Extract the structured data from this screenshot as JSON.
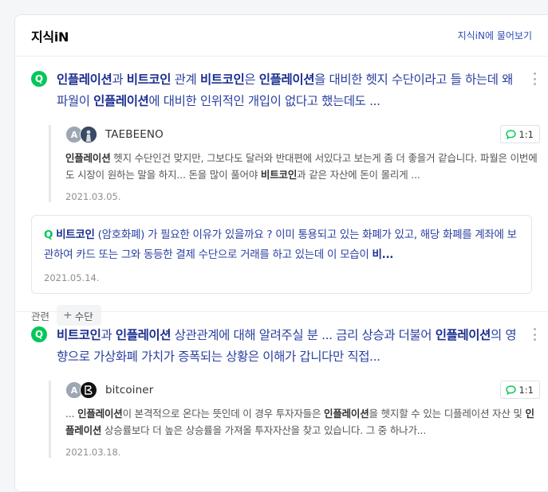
{
  "header": {
    "title": "지식iN",
    "more_link": "지식iN에 물어보기"
  },
  "entries": [
    {
      "q_badge": "Q",
      "title_parts": [
        {
          "t": "인플레이션",
          "b": true
        },
        {
          "t": "과 ",
          "b": false
        },
        {
          "t": "비트코인",
          "b": true
        },
        {
          "t": " 관계 ",
          "b": false
        },
        {
          "t": "비트코인",
          "b": true
        },
        {
          "t": "은 ",
          "b": false
        },
        {
          "t": "인플레이션",
          "b": true
        },
        {
          "t": "을 대비한 헷지 수단이라고 들 하는데 왜 파월이 ",
          "b": false
        },
        {
          "t": "인플레이션",
          "b": true
        },
        {
          "t": "에 대비한 인위적인 개입이 없다고 했는데도 ...",
          "b": false
        }
      ],
      "answer": {
        "avatar_letter": "A",
        "user": "TAEBEENO",
        "reply_count": "1:1",
        "text_parts": [
          {
            "t": "인플레이션",
            "b": true
          },
          {
            "t": " 헷지 수단인건 맞지만, 그보다도 달러와 반대편에 서있다고 보는게 좀 더 좋을거 같습니다. 파월은 이번에도 시장이 원하는 말을 하지... 돈을 많이 풀어야 ",
            "b": false
          },
          {
            "t": "비트코인",
            "b": true
          },
          {
            "t": "과 같은 자산에 돈이 몰리게 ...",
            "b": false
          }
        ],
        "date": "2021.03.05."
      },
      "related": {
        "q_badge": "Q",
        "text_parts": [
          {
            "t": "비트코인",
            "b": true
          },
          {
            "t": " (암호화폐) 가 필요한 이유가 있을까요 ? 이미 통용되고 있는 화폐가 있고, 해당 화폐를 계좌에 보관하여 카드 또는 그와 동등한 결제 수단으로 거래를 하고 있는데 이 모습이 ",
            "b": false
          },
          {
            "t": "비...",
            "b": true
          }
        ],
        "date": "2021.05.14."
      },
      "tags": {
        "label": "관련",
        "chip": "수단"
      }
    },
    {
      "q_badge": "Q",
      "title_parts": [
        {
          "t": "비트코인",
          "b": true
        },
        {
          "t": "과 ",
          "b": false
        },
        {
          "t": "인플레이션",
          "b": true
        },
        {
          "t": " 상관관계에 대해 알려주실 분 ... 금리 상승과 더불어 ",
          "b": false
        },
        {
          "t": "인플레이션",
          "b": true
        },
        {
          "t": "의 영향으로 가상화폐 가치가 증폭되는 상황은 이해가 갑니다만 직접...",
          "b": false
        }
      ],
      "answer": {
        "avatar_letter": "A",
        "user": "bitcoiner",
        "reply_count": "1:1",
        "text_parts": [
          {
            "t": "... ",
            "b": false
          },
          {
            "t": "인플레이션",
            "b": true
          },
          {
            "t": "이 본격적으로 온다는 뜻인데 이 경우 투자자들은 ",
            "b": false
          },
          {
            "t": "인플레이션",
            "b": true
          },
          {
            "t": "을 헷지할 수 있는 디플레이션 자산 및 ",
            "b": false
          },
          {
            "t": "인플레이션",
            "b": true
          },
          {
            "t": " 상승률보다 더 높은 상승률을 가져올 투자자산을 찾고 있습니다. 그 중 하나가...",
            "b": false
          }
        ],
        "date": "2021.03.18."
      }
    }
  ]
}
